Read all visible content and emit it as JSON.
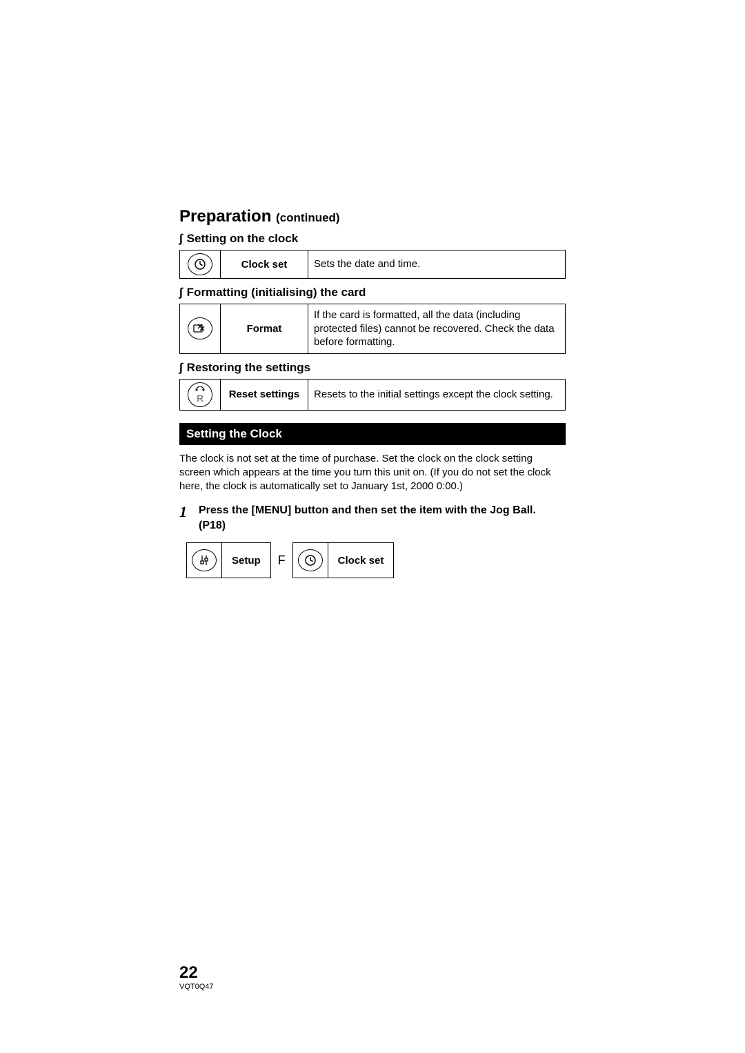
{
  "title_main": "Preparation ",
  "title_cont": "(continued)",
  "sections": {
    "s1": {
      "heading": "Setting on the clock",
      "row": {
        "name": "Clock set",
        "desc": "Sets the date and time."
      }
    },
    "s2": {
      "heading": "Formatting (initialising) the card",
      "row": {
        "name": "Format",
        "desc": "If the card is formatted, all the data (including protected files) cannot be recovered. Check the data before formatting."
      }
    },
    "s3": {
      "heading": "Restoring the settings",
      "row": {
        "name": "Reset settings",
        "desc": "Resets to the initial settings except the clock setting."
      }
    }
  },
  "black_bar": "Setting the Clock",
  "body": "The clock is not set at the time of purchase. Set the clock on the clock setting screen which appears at the time you turn this unit on. (If you do not set the clock here, the clock is automatically set to January 1st, 2000 0:00.)",
  "step": {
    "num": "1",
    "text": "Press the [MENU] button and then set the item with the Jog Ball. (P18)"
  },
  "nav": {
    "setup": "Setup",
    "arrow": "F",
    "clockset": "Clock set"
  },
  "footer": {
    "page": "22",
    "code": "VQT0Q47"
  }
}
